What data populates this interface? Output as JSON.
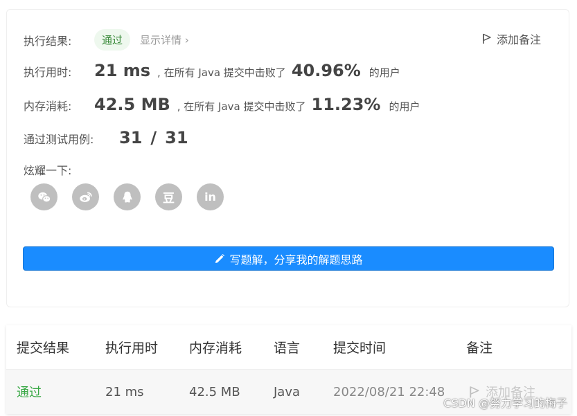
{
  "result": {
    "label": "执行结果:",
    "status": "通过",
    "details_link": "显示详情 ›",
    "add_note": "添加备注"
  },
  "runtime": {
    "label": "执行用时:",
    "value": "21 ms",
    "desc": ", 在所有 Java 提交中击败了",
    "percent": "40.96%",
    "suffix": "的用户"
  },
  "memory": {
    "label": "内存消耗:",
    "value": "42.5 MB",
    "desc": ", 在所有 Java 提交中击败了",
    "percent": "11.23%",
    "suffix": "的用户"
  },
  "tests": {
    "label": "通过测试用例:",
    "passed": "31",
    "separator": "/",
    "total": "31"
  },
  "share": {
    "label": "炫耀一下:",
    "icons": [
      "wechat-icon",
      "weibo-icon",
      "qq-icon",
      "douban-icon",
      "linkedin-icon"
    ],
    "douban_glyph": "豆",
    "linkedin_glyph": "in"
  },
  "write_button": {
    "label": "写题解，分享我的解题思路",
    "icon": "pencil-icon"
  },
  "table": {
    "headers": [
      "提交结果",
      "执行用时",
      "内存消耗",
      "语言",
      "提交时间",
      "备注"
    ],
    "rows": [
      {
        "result": "通过",
        "runtime": "21 ms",
        "memory": "42.5 MB",
        "language": "Java",
        "time": "2022/08/21 22:48",
        "note": "添加备注"
      }
    ]
  },
  "watermark": "CSDN @努力学习的梅子",
  "colors": {
    "accent": "#1a8cff",
    "pass_green": "#39a845",
    "icon_grey": "#bfbfbf"
  }
}
